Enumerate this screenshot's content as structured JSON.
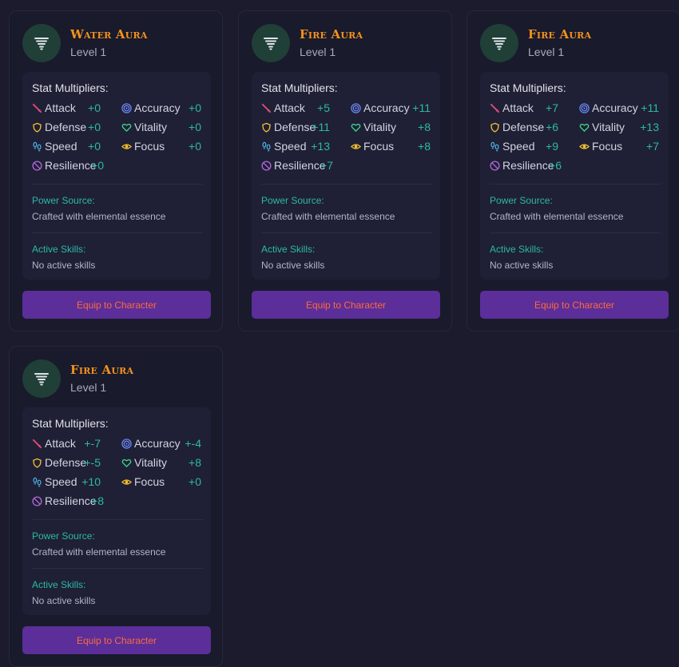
{
  "cards": [
    {
      "title": "Water Aura",
      "level": "Level 1",
      "multipliers_label": "Stat Multipliers:",
      "stats": {
        "attack": {
          "label": "Attack",
          "value": "+0"
        },
        "accuracy": {
          "label": "Accuracy",
          "value": "+0"
        },
        "defense": {
          "label": "Defense",
          "value": "+0"
        },
        "vitality": {
          "label": "Vitality",
          "value": "+0"
        },
        "speed": {
          "label": "Speed",
          "value": "+0"
        },
        "focus": {
          "label": "Focus",
          "value": "+0"
        },
        "resilience": {
          "label": "Resilience",
          "value": "+0"
        }
      },
      "power_source_label": "Power Source:",
      "power_source": "Crafted with elemental essence",
      "active_skills_label": "Active Skills:",
      "active_skills": "No active skills",
      "button": "Equip to Character"
    },
    {
      "title": "Fire Aura",
      "level": "Level 1",
      "multipliers_label": "Stat Multipliers:",
      "stats": {
        "attack": {
          "label": "Attack",
          "value": "+5"
        },
        "accuracy": {
          "label": "Accuracy",
          "value": "+11"
        },
        "defense": {
          "label": "Defense",
          "value": "+11"
        },
        "vitality": {
          "label": "Vitality",
          "value": "+8"
        },
        "speed": {
          "label": "Speed",
          "value": "+13"
        },
        "focus": {
          "label": "Focus",
          "value": "+8"
        },
        "resilience": {
          "label": "Resilience",
          "value": "+7"
        }
      },
      "power_source_label": "Power Source:",
      "power_source": "Crafted with elemental essence",
      "active_skills_label": "Active Skills:",
      "active_skills": "No active skills",
      "button": "Equip to Character"
    },
    {
      "title": "Fire Aura",
      "level": "Level 1",
      "multipliers_label": "Stat Multipliers:",
      "stats": {
        "attack": {
          "label": "Attack",
          "value": "+7"
        },
        "accuracy": {
          "label": "Accuracy",
          "value": "+11"
        },
        "defense": {
          "label": "Defense",
          "value": "+6"
        },
        "vitality": {
          "label": "Vitality",
          "value": "+13"
        },
        "speed": {
          "label": "Speed",
          "value": "+9"
        },
        "focus": {
          "label": "Focus",
          "value": "+7"
        },
        "resilience": {
          "label": "Resilience",
          "value": "+6"
        }
      },
      "power_source_label": "Power Source:",
      "power_source": "Crafted with elemental essence",
      "active_skills_label": "Active Skills:",
      "active_skills": "No active skills",
      "button": "Equip to Character"
    },
    {
      "title": "Fire Aura",
      "level": "Level 1",
      "multipliers_label": "Stat Multipliers:",
      "stats": {
        "attack": {
          "label": "Attack",
          "value": "+-7"
        },
        "accuracy": {
          "label": "Accuracy",
          "value": "+-4"
        },
        "defense": {
          "label": "Defense",
          "value": "+-5"
        },
        "vitality": {
          "label": "Vitality",
          "value": "+8"
        },
        "speed": {
          "label": "Speed",
          "value": "+10"
        },
        "focus": {
          "label": "Focus",
          "value": "+0"
        },
        "resilience": {
          "label": "Resilience",
          "value": "+8"
        }
      },
      "power_source_label": "Power Source:",
      "power_source": "Crafted with elemental essence",
      "active_skills_label": "Active Skills:",
      "active_skills": "No active skills",
      "button": "Equip to Character"
    }
  ],
  "colors": {
    "accent_title": "#f3921e",
    "stat_value": "#2bb9a8",
    "button_bg": "#5b2e9a",
    "button_text": "#ff6a3b"
  },
  "icons": {
    "card": "tornado-icon",
    "attack": "sword-icon",
    "accuracy": "target-icon",
    "defense": "shield-icon",
    "vitality": "heart-icon",
    "speed": "footprints-icon",
    "focus": "eye-icon",
    "resilience": "ban-icon"
  }
}
